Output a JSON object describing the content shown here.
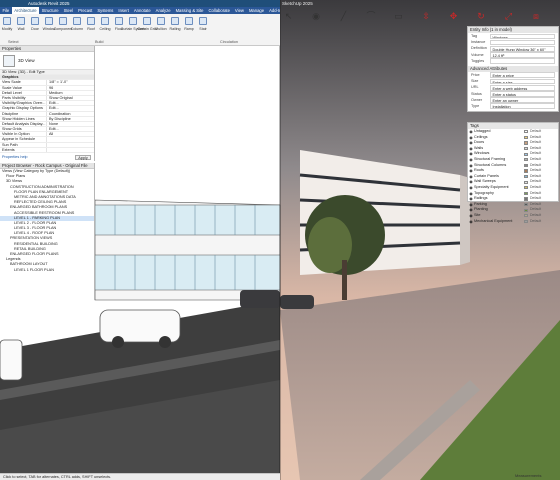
{
  "app": {
    "title": "Autodesk Revit 2025",
    "sketchup_title": "SketchUp 2025"
  },
  "revit": {
    "menu": [
      "File",
      "Architecture",
      "Structure",
      "Steel",
      "Precast",
      "Systems",
      "Insert",
      "Annotate",
      "Analyze",
      "Massing & Site",
      "Collaborate",
      "View",
      "Manage",
      "Add-Ins",
      "Modify"
    ],
    "menu_active": "Architecture",
    "ribbon_tools": [
      "Modify",
      "Wall",
      "Door",
      "Window",
      "Component",
      "Column",
      "Roof",
      "Ceiling",
      "Floor",
      "Curtain System",
      "Curtain Grid",
      "Mullion",
      "Railing",
      "Ramp",
      "Stair"
    ],
    "ribbon_groups": [
      "Select",
      "Build",
      "Circulation"
    ],
    "properties": {
      "title": "Properties",
      "type_name": "3D View",
      "selector": "3D View: {3D} - Edit Type",
      "section": "Graphics",
      "rows": [
        {
          "k": "View Scale",
          "v": "1/8\" = 1'-0\""
        },
        {
          "k": "Scale Value",
          "v": "96"
        },
        {
          "k": "Detail Level",
          "v": "Medium"
        },
        {
          "k": "Parts Visibility",
          "v": "Show Original"
        },
        {
          "k": "Visibility/Graphics Overr...",
          "v": "Edit..."
        },
        {
          "k": "Graphic Display Options",
          "v": "Edit..."
        },
        {
          "k": "Discipline",
          "v": "Coordination"
        },
        {
          "k": "Show Hidden Lines",
          "v": "By Discipline"
        },
        {
          "k": "Default Analysis Display...",
          "v": "None"
        },
        {
          "k": "Show Grids",
          "v": "Edit..."
        },
        {
          "k": "Visible In Option",
          "v": "All"
        },
        {
          "k": "Appear in Schedule",
          "v": ""
        },
        {
          "k": "Sun Path",
          "v": ""
        },
        {
          "k": "Extents",
          "v": ""
        }
      ],
      "help_link": "Properties help",
      "apply_label": "Apply"
    },
    "browser": {
      "title": "Project Browser - Rock Campus - Original File",
      "items": [
        "Views (View Category by Type (Default))",
        "Floor Plans",
        "3D Views",
        "CONSTRUCTION ADMINISTRATION",
        "FLOOR PLAN ENLARGEMENT",
        "METRIC AND ANNOTATIONS DATA",
        "REFLECTED CEILING PLANS",
        "ENLARGED BATHROOM PLANS",
        "ACCESSIBLE RESTROOM PLANS",
        "LEVEL 1 - PARKING PLAN",
        "LEVEL 2 - FLOOR PLAN",
        "LEVEL 3 - FLOOR PLAN",
        "LEVEL 4 - ROOF PLAN",
        "PRESENTATION VIEWS",
        "RESIDENTIAL BUILDING",
        "RETAIL BUILDING",
        "ENLARGED FLOOR PLANS",
        "Legends",
        "BATHROOM LAYOUT",
        "LEVEL 1 FLOOR PLAN"
      ]
    },
    "status": "Click to select, TAB for alternates, CTRL adds, SHIFT unselects."
  },
  "sketchup": {
    "tools": [
      "select",
      "paint",
      "line",
      "arc",
      "shape",
      "push-pull",
      "move",
      "rotate",
      "scale",
      "offset",
      "tape",
      "text",
      "orbit",
      "pan",
      "zoom",
      "zoom-extents",
      "section"
    ],
    "entity_info": {
      "title": "Entity Info (1 in model)",
      "rows": [
        {
          "k": "Tag",
          "v": "Windows"
        },
        {
          "k": "Instance",
          "v": ""
        },
        {
          "k": "Definition",
          "v": "Double Hung Window 36\" x 60\""
        },
        {
          "k": "Volume",
          "v": "12.4 ft³"
        },
        {
          "k": "Toggles",
          "v": ""
        }
      ],
      "advanced_title": "Advanced Attributes",
      "adv_rows": [
        {
          "k": "Price",
          "v": "Enter a price"
        },
        {
          "k": "Size",
          "v": "Enter a size"
        },
        {
          "k": "URL",
          "v": "Enter a web address"
        },
        {
          "k": "Status",
          "v": "Enter a status"
        },
        {
          "k": "Owner",
          "v": "Enter an owner"
        },
        {
          "k": "Type",
          "v": "Installation"
        }
      ]
    },
    "tags": {
      "title": "Tags",
      "rows": [
        {
          "name": "Untagged",
          "color": "#ffffff",
          "dash": "Default"
        },
        {
          "name": "Ceilings",
          "color": "#f0d27a",
          "dash": "Default"
        },
        {
          "name": "Doors",
          "color": "#c8a080",
          "dash": "Default"
        },
        {
          "name": "Walls",
          "color": "#d9d9d9",
          "dash": "Default"
        },
        {
          "name": "Windows",
          "color": "#9fc9ea",
          "dash": "Default"
        },
        {
          "name": "Structural Framing",
          "color": "#b3b3b3",
          "dash": "Default"
        },
        {
          "name": "Structural Columns",
          "color": "#8c8c8c",
          "dash": "Default"
        },
        {
          "name": "Roofs",
          "color": "#a97f5d",
          "dash": "Default"
        },
        {
          "name": "Curtain Panels",
          "color": "#88b7d5",
          "dash": "Default"
        },
        {
          "name": "Wall Sweeps",
          "color": "#e5e5e5",
          "dash": "Default"
        },
        {
          "name": "Specialty Equipment",
          "color": "#d4c16b",
          "dash": "Default"
        },
        {
          "name": "Topography",
          "color": "#7ba05b",
          "dash": "Default"
        },
        {
          "name": "Railings",
          "color": "#777777",
          "dash": "Default"
        },
        {
          "name": "Parking",
          "color": "#555555",
          "dash": "Default"
        },
        {
          "name": "Planting",
          "color": "#6b8e3a",
          "dash": "Default"
        },
        {
          "name": "Site",
          "color": "#b5a88a",
          "dash": "Default"
        },
        {
          "name": "Mechanical Equipment",
          "color": "#9e9e9e",
          "dash": "Default"
        }
      ]
    },
    "status": "Measurements"
  }
}
